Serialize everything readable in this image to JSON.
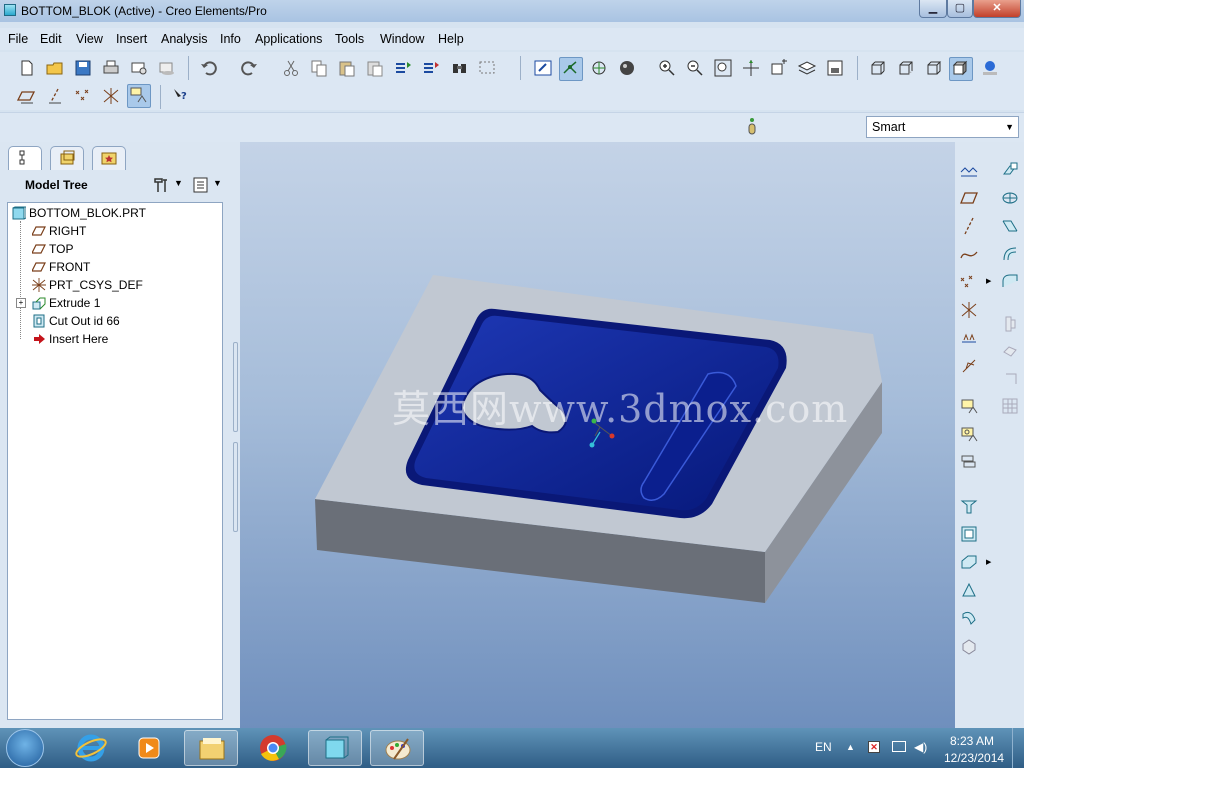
{
  "window": {
    "title": "BOTTOM_BLOK (Active) - Creo Elements/Pro",
    "app_icon": "creo-part-icon",
    "controls": [
      "minimize-icon",
      "maximize-icon",
      "close-icon"
    ]
  },
  "menu": [
    "File",
    "Edit",
    "View",
    "Insert",
    "Analysis",
    "Info",
    "Applications",
    "Tools",
    "Window",
    "Help"
  ],
  "toolbar": {
    "row1_icons": [
      "new-icon",
      "open-icon",
      "save-icon",
      "print-icon",
      "send-mail-icon",
      "mail-attach-icon",
      "undo-icon",
      "redo-icon",
      "cut-icon",
      "copy-icon",
      "paste-icon",
      "paste-special-icon",
      "regenerate-icon",
      "regen-manager-icon",
      "find-icon",
      "select-box-icon",
      "repaint-icon",
      "spin-center-icon",
      "orient-mode-icon",
      "appearance-icon",
      "zoom-in-icon",
      "zoom-out-icon",
      "refit-icon",
      "reorient-icon",
      "saved-views-icon",
      "layers-icon",
      "view-manager-icon",
      "wireframe-icon",
      "hidden-line-icon",
      "no-hidden-icon",
      "shading-icon",
      "enhanced-realism-icon"
    ],
    "row2_icons": [
      "datum-planes-icon",
      "datum-axes-icon",
      "datum-points-icon",
      "datum-csys-icon",
      "annotation-display-icon",
      "context-help-icon"
    ]
  },
  "filter": {
    "status_icon": "status-light-icon",
    "selection_filter": "Smart"
  },
  "panel_tabs": [
    "model-tree-tab-icon",
    "folder-browser-tab-icon",
    "favorites-tab-icon"
  ],
  "model_tree": {
    "header": "Model Tree",
    "header_icons": [
      "settings-icon",
      "show-icon"
    ],
    "items": [
      {
        "label": "BOTTOM_BLOK.PRT",
        "icon": "part-icon"
      },
      {
        "label": "RIGHT",
        "icon": "datum-plane-icon"
      },
      {
        "label": "TOP",
        "icon": "datum-plane-icon"
      },
      {
        "label": "FRONT",
        "icon": "datum-plane-icon"
      },
      {
        "label": "PRT_CSYS_DEF",
        "icon": "csys-icon"
      },
      {
        "label": "Extrude 1",
        "icon": "extrude-icon"
      },
      {
        "label": "Cut Out id 66",
        "icon": "cut-out-icon"
      },
      {
        "label": "Insert Here",
        "icon": "insert-arrow-icon"
      }
    ]
  },
  "viewport": {
    "watermark": "莫西网www.3dmox.com"
  },
  "right_toolbar": {
    "icons": [
      "sketch-icon",
      "plane-icon",
      "axis-icon",
      "curve-icon",
      "point-icon",
      "csys-icon",
      "analysis-icon",
      "coord-icon",
      "feature-icon",
      "sketch-tool-icon",
      "sketched-datum-icon",
      "hole-icon",
      "shell-icon",
      "rib-icon",
      "draft-icon",
      "round-icon",
      "chamfer-icon",
      "extrude-tool-icon",
      "revolve-icon",
      "sweep-icon",
      "blend-icon",
      "boundary-blend-icon",
      "mirror-icon",
      "merge-icon",
      "trim-icon",
      "pattern-icon"
    ]
  },
  "taskbar": {
    "apps": [
      "start-orb-icon",
      "internet-explorer-icon",
      "media-player-icon",
      "file-explorer-icon",
      "chrome-icon",
      "creo-icon",
      "paint-icon"
    ],
    "language": "EN",
    "tray_icons": [
      "show-hidden-icon",
      "action-center-icon",
      "network-icon",
      "volume-icon"
    ],
    "time": "8:23 AM",
    "date": "12/23/2014"
  },
  "colors": {
    "cavity": "#0a1f8c",
    "block_top": "#c1c8d2",
    "block_front": "#6b7079",
    "block_side": "#8b919a"
  }
}
